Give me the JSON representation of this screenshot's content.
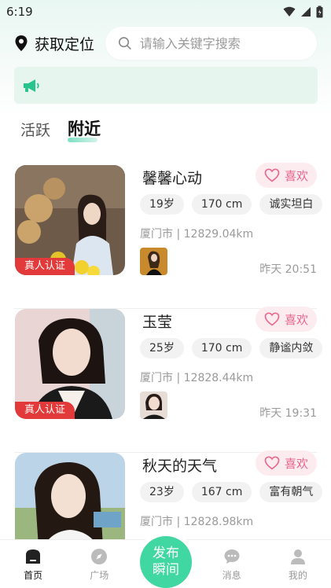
{
  "status_bar": {
    "time": "6:19"
  },
  "header": {
    "location_label": "获取定位",
    "search_placeholder": "请输入关键字搜索"
  },
  "tabs": [
    {
      "label": "活跃"
    },
    {
      "label": "附近"
    }
  ],
  "cards": [
    {
      "name": "馨馨心动",
      "like_label": "喜欢",
      "verified_label": "真人认证",
      "tags": [
        "19岁",
        "170 cm",
        "诚实坦白"
      ],
      "city": "厦门市",
      "distance": "12829.04km",
      "time": "昨天 20:51"
    },
    {
      "name": "玉莹",
      "like_label": "喜欢",
      "verified_label": "真人认证",
      "tags": [
        "25岁",
        "170 cm",
        "静谧内敛"
      ],
      "city": "厦门市",
      "distance": "12828.44km",
      "time": "昨天 19:31"
    },
    {
      "name": "秋天的天气",
      "like_label": "喜欢",
      "tags": [
        "23岁",
        "167 cm",
        "富有朝气"
      ],
      "city": "厦门市",
      "distance": "12828.98km"
    }
  ],
  "bottom_nav": {
    "home": "首页",
    "square": "广场",
    "publish_line1": "发布",
    "publish_line2": "瞬间",
    "messages": "消息",
    "mine": "我的"
  },
  "colors": {
    "accent": "#41d7a2",
    "like": "#e9668c",
    "verify": "#e23a3a"
  }
}
